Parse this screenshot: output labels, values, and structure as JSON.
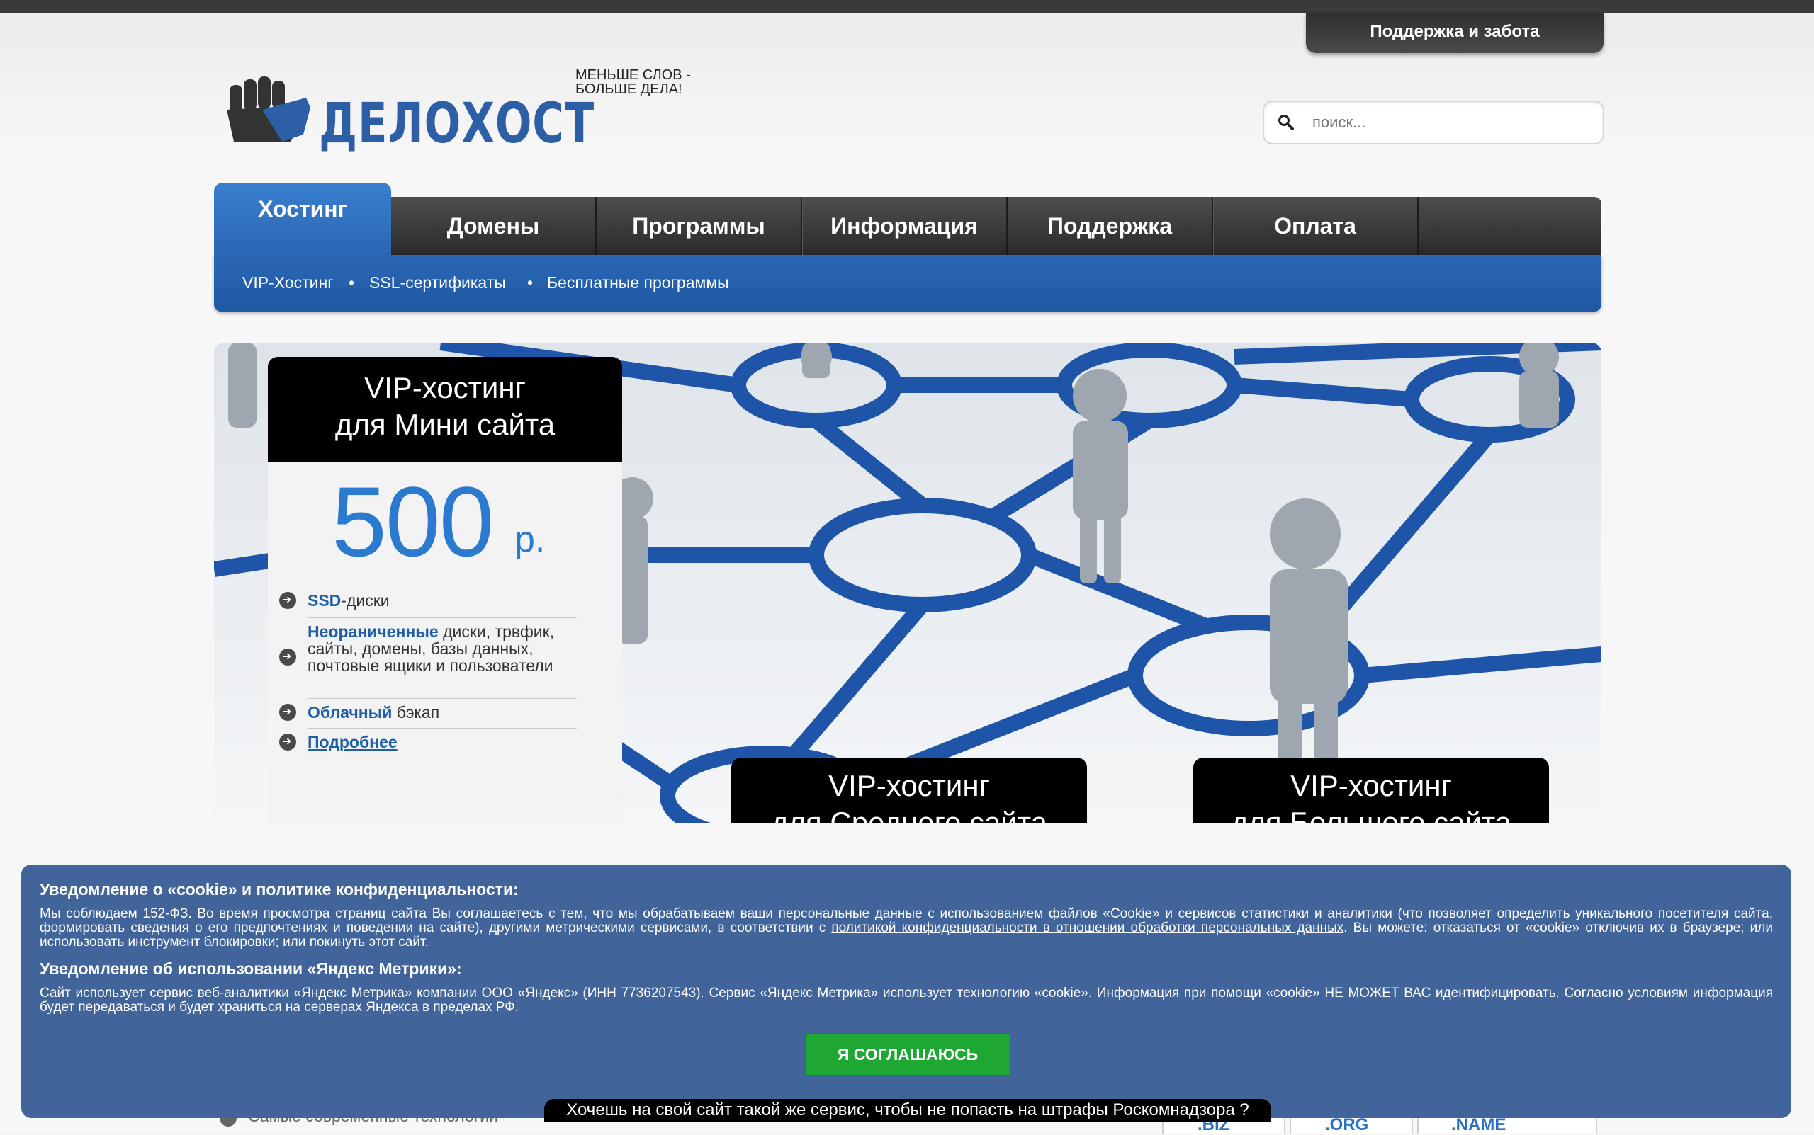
{
  "header": {
    "support_tab": "Поддержка и забота",
    "logo_text": "ДЕЛОХОСТ",
    "tagline_line1": "МЕНЬШЕ СЛОВ -",
    "tagline_line2": "БОЛЬШЕ ДЕЛА!",
    "search_placeholder": "поиск..."
  },
  "nav": {
    "items": [
      {
        "label": "Хостинг",
        "active": true
      },
      {
        "label": "Домены"
      },
      {
        "label": "Программы"
      },
      {
        "label": "Информация"
      },
      {
        "label": "Поддержка"
      },
      {
        "label": "Оплата"
      }
    ],
    "subnav": [
      "VIP-Хостинг",
      "SSL-сертификаты",
      "Бесплатные программы"
    ]
  },
  "banner": {
    "mini": {
      "title_line1": "VIP-хостинг",
      "title_line2": "для Мини сайта",
      "price": "500",
      "unit": "р.",
      "features": [
        {
          "bold": "SSD",
          "text": "-диски"
        },
        {
          "bold": "Неораниченные",
          "text": " диски, трвфик, сайты, домены, базы данных, почтовые ящики и пользователи"
        },
        {
          "bold": "Облачный",
          "text": " бэкап"
        },
        {
          "link": "Подробнее"
        }
      ]
    },
    "middle": {
      "title_line1": "VIP-хостинг",
      "title_line2": "для Среднего сайта"
    },
    "large": {
      "title_line1": "VIP-хостинг",
      "title_line2": "для Большого сайта"
    }
  },
  "cookie": {
    "heading1": "Уведомление о «cookie» и политике конфиденциальности:",
    "text1_a": "Мы соблюдаем 152-ФЗ. Во время просмотра страниц сайта Вы соглашаетесь с тем, что мы обрабатываем ваши персональные данные с использованием файлов «Cookie» и сервисов статистики и аналитики (что позволяет определить уникального посетителя сайта, формировать сведения о его предпочтениях и поведении на сайте), другими метрическими сервисами, в соответствии с ",
    "text1_link": "политикой конфиденциальности в отношении обработки персональных данных",
    "text1_b": ". Вы можете: отказаться от «cookie» отключив их в браузере; или использовать ",
    "text1_link2": "инструмент блокировки",
    "text1_c": "; или покинуть этот сайт.",
    "heading2": "Уведомление об использовании «Яндекс Метрики»:",
    "text2_a": "Сайт использует сервис веб-аналитики «Яндекс Метрика» компании ООО «Яндекс» (ИНН 7736207543). Сервис «Яндекс Метрика» использует технологию «cookie». Информация при помощи «cookie» НЕ МОЖЕТ ВАС идентифицировать. Согласно ",
    "text2_link": "условиям",
    "text2_b": " информация будет передаваться и будет храниться на серверах Яндекса в пределах РФ.",
    "agree_button": "Я СОГЛАШАЮСЬ",
    "promo": "Хочешь на свой сайт такой же сервис, чтобы не попасть на штрафы Роскомнадзора ?"
  },
  "bottom": {
    "feature_text": "Самые современные технологии",
    "domains": [
      ".BIZ",
      ".ORG",
      ".NAME"
    ]
  },
  "colors": {
    "accent_blue": "#2a66b4",
    "cookie_bg": "#41649a",
    "agree_green": "#1ea733",
    "nav_dark": "#2a2a2a"
  }
}
